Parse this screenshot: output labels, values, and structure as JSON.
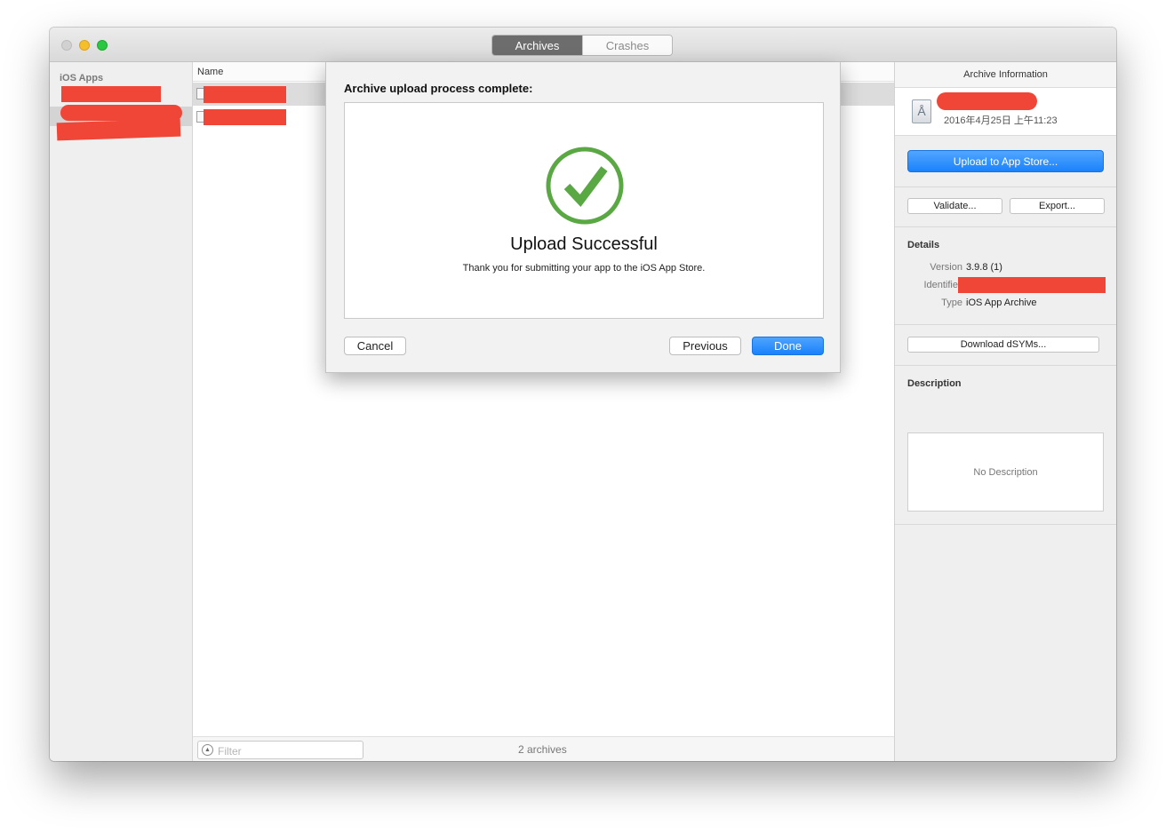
{
  "toolbar": {
    "tab_archives": "Archives",
    "tab_crashes": "Crashes"
  },
  "sidebar": {
    "header": "iOS Apps"
  },
  "list": {
    "column_name": "Name",
    "filter_placeholder": "Filter",
    "count": "2 archives"
  },
  "info": {
    "title": "Archive Information",
    "date": "2016年4月25日 上午11:23",
    "upload_label": "Upload to App Store...",
    "validate_label": "Validate...",
    "export_label": "Export...",
    "details_header": "Details",
    "version_key": "Version",
    "version_value": "3.9.8 (1)",
    "identifier_key": "Identifie",
    "type_key": "Type",
    "type_value": "iOS App Archive",
    "dsyms_label": "Download dSYMs...",
    "description_header": "Description",
    "description_value": "No Description"
  },
  "dialog": {
    "title": "Archive upload process complete:",
    "success_title": "Upload Successful",
    "success_message": "Thank you for submitting your app to the iOS App Store.",
    "cancel_label": "Cancel",
    "previous_label": "Previous",
    "done_label": "Done"
  },
  "colors": {
    "success_green": "#5aa844",
    "accent_blue": "#1a82fb",
    "redaction_red": "#ef4638"
  }
}
